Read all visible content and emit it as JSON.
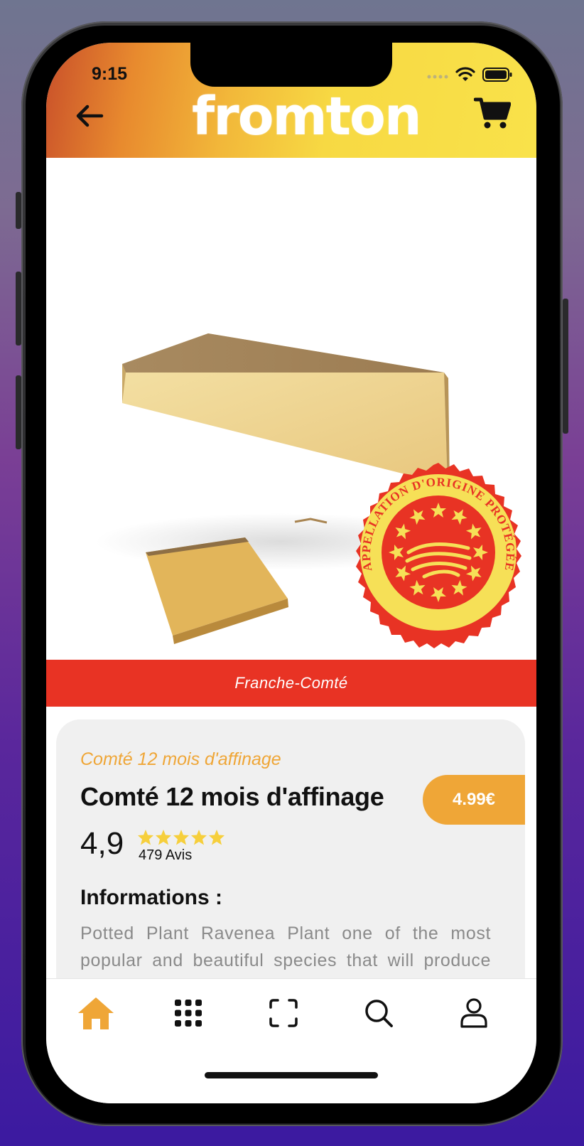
{
  "status_bar": {
    "time": "9:15"
  },
  "header": {
    "logo_text": "fromton",
    "back_icon": "arrow-left-icon",
    "cart_icon": "cart-icon"
  },
  "product": {
    "image_description_icon": "cheese-wedge-image",
    "seal_top_text": "APPELLATION D'ORIGINE PROTÉGÉE",
    "region": "Franche-Comté",
    "subtitle": "Comté 12 mois d'affinage",
    "title": "Comté 12 mois d'affinage",
    "price": "4.99€",
    "rating": "4,9",
    "stars": 5,
    "reviews": "479 Avis",
    "info_heading": "Informations :",
    "description": "Potted Plant Ravenea Plant one of the most popular and beautiful species that will produce clumpms. The storage of water often"
  },
  "tabbar": {
    "items": [
      {
        "name": "home",
        "icon": "home-icon",
        "active": true
      },
      {
        "name": "categories",
        "icon": "grid-icon",
        "active": false
      },
      {
        "name": "scan",
        "icon": "scan-icon",
        "active": false
      },
      {
        "name": "search",
        "icon": "search-icon",
        "active": false
      },
      {
        "name": "profile",
        "icon": "user-icon",
        "active": false
      }
    ]
  },
  "colors": {
    "accent": "#efa637",
    "region_band": "#e83324",
    "star": "#f6cf3c"
  }
}
